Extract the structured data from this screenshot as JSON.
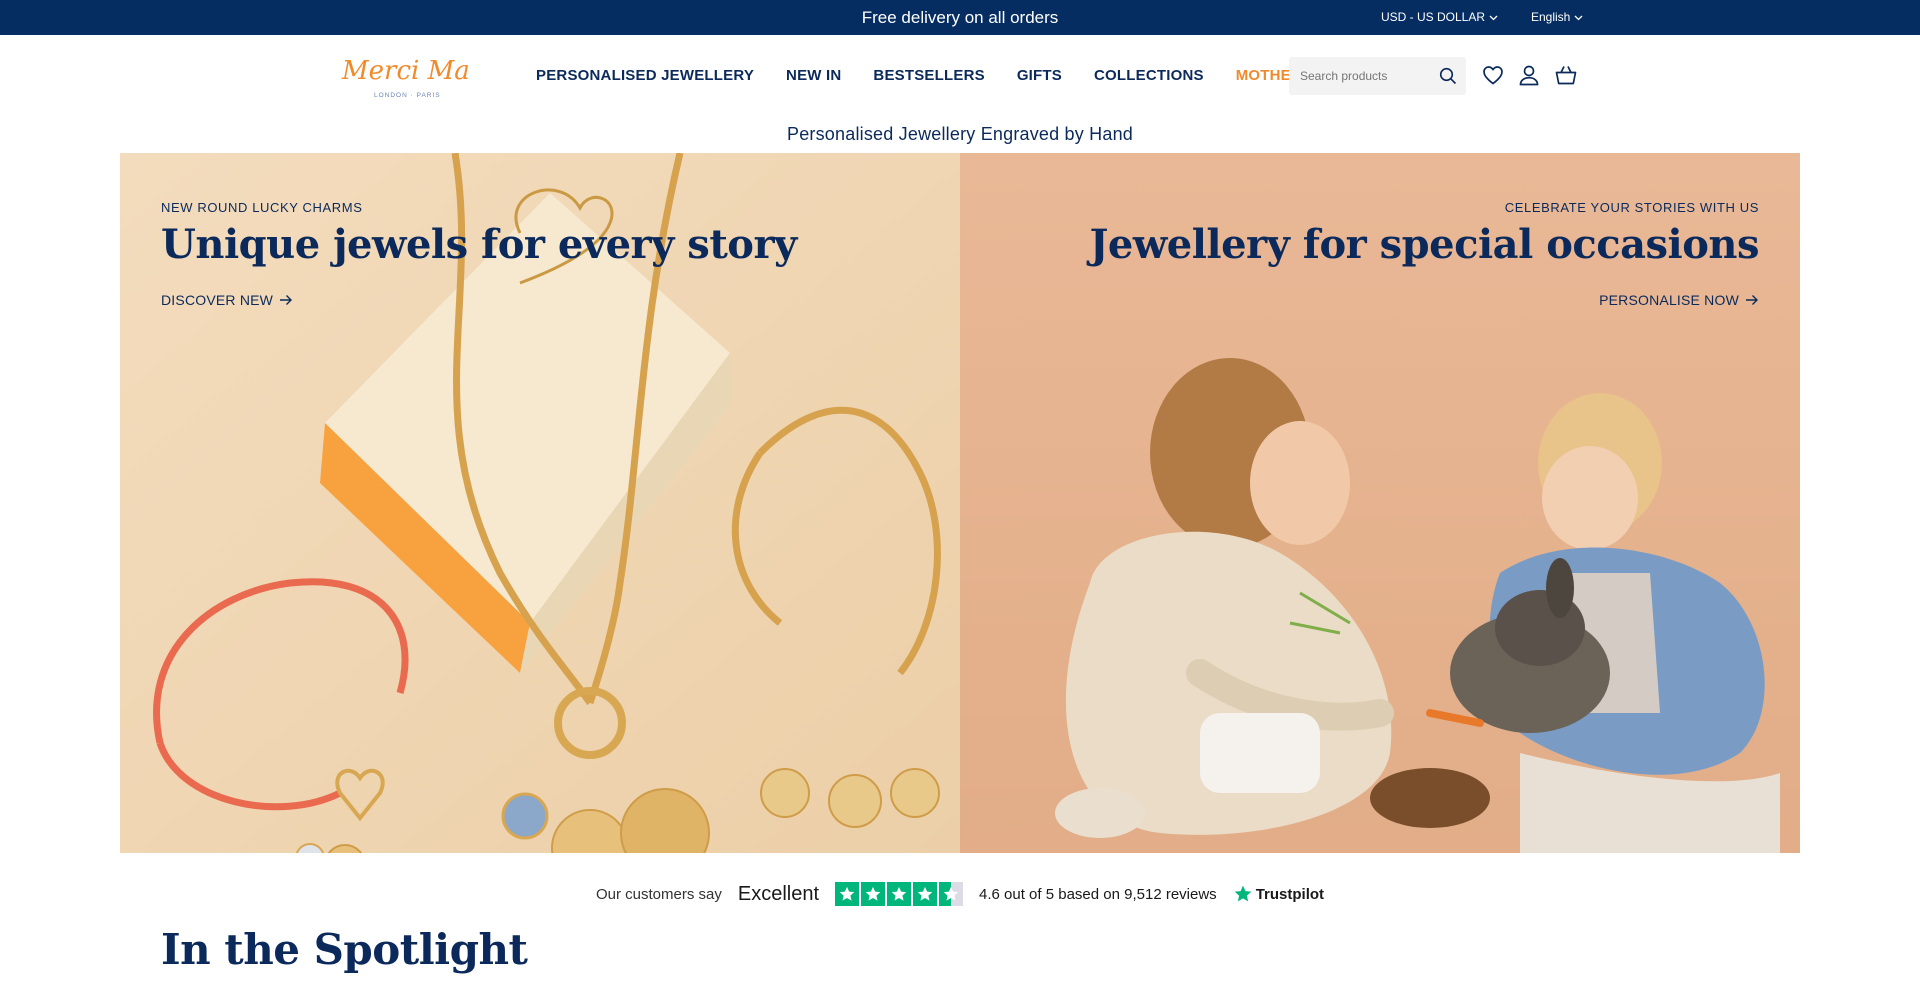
{
  "topbar": {
    "promo": "Free delivery on all orders",
    "currency": "USD - US DOLLAR",
    "language": "English"
  },
  "header": {
    "logo_text": "Merci Maman",
    "logo_subtext": "LONDON · PARIS",
    "nav": [
      {
        "label": "PERSONALISED JEWELLERY"
      },
      {
        "label": "NEW IN"
      },
      {
        "label": "BESTSELLERS"
      },
      {
        "label": "GIFTS"
      },
      {
        "label": "COLLECTIONS"
      },
      {
        "label": "MOTHER'S DAY"
      }
    ],
    "search_placeholder": "Search products",
    "icons": [
      "search-icon",
      "heart-icon",
      "account-icon",
      "basket-icon"
    ]
  },
  "tagline": "Personalised Jewellery Engraved by Hand",
  "hero": {
    "left": {
      "eyebrow": "NEW ROUND LUCKY CHARMS",
      "title": "Unique jewels for every story",
      "cta": "DISCOVER NEW"
    },
    "right": {
      "eyebrow": "CELEBRATE YOUR STORIES WITH US",
      "title": "Jewellery for special occasions",
      "cta": "PERSONALISE NOW"
    }
  },
  "reviews": {
    "say": "Our customers say",
    "rating_word": "Excellent",
    "rating_value": 4.6,
    "score_text": "4.6 out of 5 based on 9,512 reviews",
    "brand": "Trustpilot"
  },
  "section_title": "In the Spotlight",
  "colors": {
    "navy": "#062d62",
    "text_navy": "#0b2a5b",
    "accent_orange": "#f08a2b",
    "trustpilot_green": "#00b67a"
  }
}
